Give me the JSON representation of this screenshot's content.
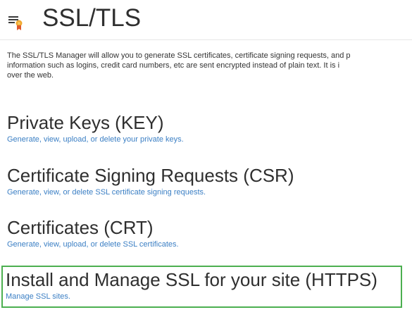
{
  "header": {
    "title": "SSL/TLS",
    "icon": "ssl-certificate-icon",
    "accent_colors": [
      "#3b3b3b",
      "#f0a830",
      "#e05a2b"
    ]
  },
  "description": {
    "line1": "The SSL/TLS Manager will allow you to generate SSL certificates, certificate signing requests, and p",
    "line2": "information such as logins, credit card numbers, etc are sent encrypted instead of plain text. It is i",
    "line3": "over the web."
  },
  "sections": [
    {
      "title": "Private Keys (KEY)",
      "link": "Generate, view, upload, or delete your private keys."
    },
    {
      "title": "Certificate Signing Requests (CSR)",
      "link": "Generate, view, or delete SSL certificate signing requests."
    },
    {
      "title": "Certificates (CRT)",
      "link": "Generate, view, upload, or delete SSL certificates."
    },
    {
      "title": "Install and Manage SSL for your site (HTTPS)",
      "link": "Manage SSL sites.",
      "highlighted": true
    }
  ],
  "colors": {
    "link": "#3b7fc4",
    "highlight_border": "#4caf50",
    "text": "#333333"
  }
}
